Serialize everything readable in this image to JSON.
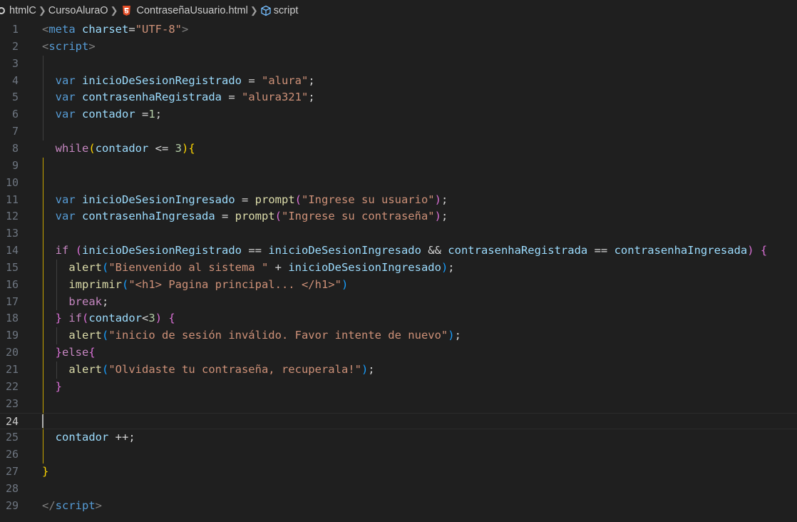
{
  "breadcrumb": {
    "items": [
      "htmlC",
      "CursoAluraO",
      "ContraseñaUsuario.html",
      "script"
    ]
  },
  "editor": {
    "active_line": 24,
    "lines": [
      {
        "n": "1",
        "tokens": [
          [
            "tagb",
            "<"
          ],
          [
            "tag",
            "meta"
          ],
          [
            "op",
            " "
          ],
          [
            "attr",
            "charset"
          ],
          [
            "op",
            "="
          ],
          [
            "str",
            "\"UTF-8\""
          ],
          [
            "tagb",
            ">"
          ]
        ]
      },
      {
        "n": "2",
        "tokens": [
          [
            "tagb",
            "<"
          ],
          [
            "tag",
            "script"
          ],
          [
            "tagb",
            ">"
          ]
        ]
      },
      {
        "n": "3",
        "tokens": []
      },
      {
        "n": "4",
        "tokens": [
          [
            "op",
            "  "
          ],
          [
            "kw",
            "var"
          ],
          [
            "op",
            " "
          ],
          [
            "var",
            "inicioDeSesionRegistrado"
          ],
          [
            "op",
            " = "
          ],
          [
            "str",
            "\"alura\""
          ],
          [
            "op",
            ";"
          ]
        ]
      },
      {
        "n": "5",
        "tokens": [
          [
            "op",
            "  "
          ],
          [
            "kw",
            "var"
          ],
          [
            "op",
            " "
          ],
          [
            "var",
            "contrasenhaRegistrada"
          ],
          [
            "op",
            " = "
          ],
          [
            "str",
            "\"alura321\""
          ],
          [
            "op",
            ";"
          ]
        ]
      },
      {
        "n": "6",
        "tokens": [
          [
            "op",
            "  "
          ],
          [
            "kw",
            "var"
          ],
          [
            "op",
            " "
          ],
          [
            "var",
            "contador"
          ],
          [
            "op",
            " ="
          ],
          [
            "num",
            "1"
          ],
          [
            "op",
            ";"
          ]
        ]
      },
      {
        "n": "7",
        "tokens": []
      },
      {
        "n": "8",
        "tokens": [
          [
            "op",
            "  "
          ],
          [
            "ctrl",
            "while"
          ],
          [
            "br1",
            "("
          ],
          [
            "var",
            "contador"
          ],
          [
            "op",
            " <= "
          ],
          [
            "num",
            "3"
          ],
          [
            "br1",
            ")"
          ],
          [
            "br1",
            "{"
          ]
        ]
      },
      {
        "n": "9",
        "tokens": []
      },
      {
        "n": "10",
        "tokens": []
      },
      {
        "n": "11",
        "tokens": [
          [
            "op",
            "  "
          ],
          [
            "kw",
            "var"
          ],
          [
            "op",
            " "
          ],
          [
            "var",
            "inicioDeSesionIngresado"
          ],
          [
            "op",
            " = "
          ],
          [
            "fn",
            "prompt"
          ],
          [
            "br2",
            "("
          ],
          [
            "str",
            "\"Ingrese su usuario\""
          ],
          [
            "br2",
            ")"
          ],
          [
            "op",
            ";"
          ]
        ]
      },
      {
        "n": "12",
        "tokens": [
          [
            "op",
            "  "
          ],
          [
            "kw",
            "var"
          ],
          [
            "op",
            " "
          ],
          [
            "var",
            "contrasenhaIngresada"
          ],
          [
            "op",
            " = "
          ],
          [
            "fn",
            "prompt"
          ],
          [
            "br2",
            "("
          ],
          [
            "str",
            "\"Ingrese su contraseña\""
          ],
          [
            "br2",
            ")"
          ],
          [
            "op",
            ";"
          ]
        ]
      },
      {
        "n": "13",
        "tokens": []
      },
      {
        "n": "14",
        "tokens": [
          [
            "op",
            "  "
          ],
          [
            "ctrl",
            "if"
          ],
          [
            "op",
            " "
          ],
          [
            "br2",
            "("
          ],
          [
            "var",
            "inicioDeSesionRegistrado"
          ],
          [
            "op",
            " == "
          ],
          [
            "var",
            "inicioDeSesionIngresado"
          ],
          [
            "op",
            " && "
          ],
          [
            "var",
            "contrasenhaRegistrada"
          ],
          [
            "op",
            " == "
          ],
          [
            "var",
            "contrasenhaIngresada"
          ],
          [
            "br2",
            ")"
          ],
          [
            "op",
            " "
          ],
          [
            "br2",
            "{"
          ]
        ]
      },
      {
        "n": "15",
        "tokens": [
          [
            "op",
            "    "
          ],
          [
            "fn",
            "alert"
          ],
          [
            "br3",
            "("
          ],
          [
            "str",
            "\"Bienvenido al sistema \""
          ],
          [
            "op",
            " + "
          ],
          [
            "var",
            "inicioDeSesionIngresado"
          ],
          [
            "br3",
            ")"
          ],
          [
            "op",
            ";"
          ]
        ]
      },
      {
        "n": "16",
        "tokens": [
          [
            "op",
            "    "
          ],
          [
            "fn",
            "imprimir"
          ],
          [
            "br3",
            "("
          ],
          [
            "str",
            "\"<h1> Pagina principal... </h1>\""
          ],
          [
            "br3",
            ")"
          ]
        ]
      },
      {
        "n": "17",
        "tokens": [
          [
            "op",
            "    "
          ],
          [
            "ctrl",
            "break"
          ],
          [
            "op",
            ";"
          ]
        ]
      },
      {
        "n": "18",
        "tokens": [
          [
            "op",
            "  "
          ],
          [
            "br2",
            "}"
          ],
          [
            "op",
            " "
          ],
          [
            "ctrl",
            "if"
          ],
          [
            "br2",
            "("
          ],
          [
            "var",
            "contador"
          ],
          [
            "op",
            "<"
          ],
          [
            "num",
            "3"
          ],
          [
            "br2",
            ")"
          ],
          [
            "op",
            " "
          ],
          [
            "br2",
            "{"
          ]
        ]
      },
      {
        "n": "19",
        "tokens": [
          [
            "op",
            "    "
          ],
          [
            "fn",
            "alert"
          ],
          [
            "br3",
            "("
          ],
          [
            "str",
            "\"inicio de sesión inválido. Favor intente de nuevo\""
          ],
          [
            "br3",
            ")"
          ],
          [
            "op",
            ";"
          ]
        ]
      },
      {
        "n": "20",
        "tokens": [
          [
            "op",
            "  "
          ],
          [
            "br2",
            "}"
          ],
          [
            "ctrl",
            "else"
          ],
          [
            "br2",
            "{"
          ]
        ]
      },
      {
        "n": "21",
        "tokens": [
          [
            "op",
            "    "
          ],
          [
            "fn",
            "alert"
          ],
          [
            "br3",
            "("
          ],
          [
            "str",
            "\"Olvidaste tu contraseña, recuperala!\""
          ],
          [
            "br3",
            ")"
          ],
          [
            "op",
            ";"
          ]
        ]
      },
      {
        "n": "22",
        "tokens": [
          [
            "op",
            "  "
          ],
          [
            "br2",
            "}"
          ]
        ]
      },
      {
        "n": "23",
        "tokens": []
      },
      {
        "n": "24",
        "tokens": []
      },
      {
        "n": "25",
        "tokens": [
          [
            "op",
            "  "
          ],
          [
            "var",
            "contador"
          ],
          [
            "op",
            " ++;"
          ]
        ]
      },
      {
        "n": "26",
        "tokens": []
      },
      {
        "n": "27",
        "tokens": [
          [
            "br1",
            "}"
          ]
        ]
      },
      {
        "n": "28",
        "tokens": []
      },
      {
        "n": "29",
        "tokens": [
          [
            "tagb",
            "</"
          ],
          [
            "tag",
            "script"
          ],
          [
            "tagb",
            ">"
          ]
        ]
      }
    ]
  }
}
